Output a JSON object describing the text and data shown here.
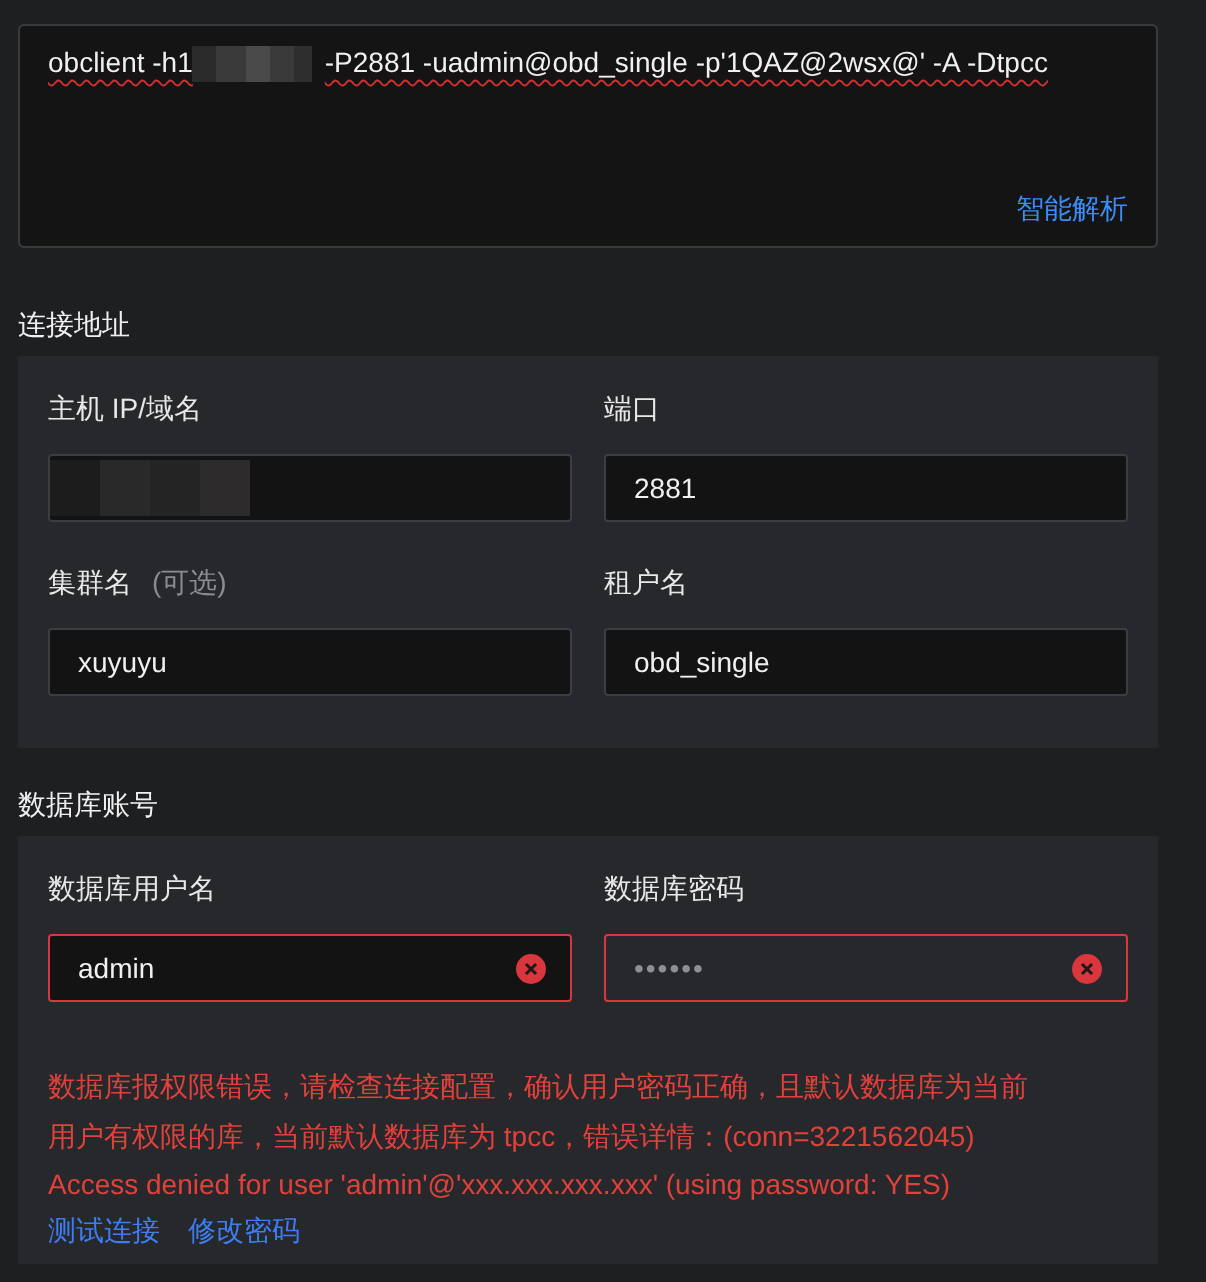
{
  "command": {
    "parts": [
      "obclient -h1",
      "-P2881 -uadmin@obd_single -p'1QAZ@2wsx@' -A -Dtpcc"
    ],
    "redacted": true,
    "action": "智能解析"
  },
  "sections": [
    {
      "title": "连接地址",
      "fields": [
        {
          "label": "主机 IP/域名",
          "redacted": true,
          "error": false,
          "kind": "text"
        },
        {
          "label": "端口",
          "value": "2881",
          "error": false,
          "kind": "text"
        },
        {
          "label": "集群名",
          "hint": "(可选)",
          "value": "xuyuyu",
          "error": false,
          "kind": "text"
        },
        {
          "label": "租户名",
          "value": "obd_single",
          "error": false,
          "kind": "text"
        }
      ]
    },
    {
      "title": "数据库账号",
      "fields": [
        {
          "label": "数据库用户名",
          "value": "admin",
          "error": true,
          "kind": "text"
        },
        {
          "label": "数据库密码",
          "value": "••••••",
          "error": true,
          "kind": "password"
        }
      ],
      "error_lines": [
        "数据库报权限错误，请检查连接配置，确认用户密码正确，且默认数据库为当前",
        "用户有权限的库，当前默认数据库为 tpcc，错误详情：(conn=3221562045)",
        "Access denied for user 'admin'@'xxx.xxx.xxx.xxx' (using password: YES)"
      ],
      "links": [
        "测试连接",
        "修改密码"
      ]
    }
  ]
}
